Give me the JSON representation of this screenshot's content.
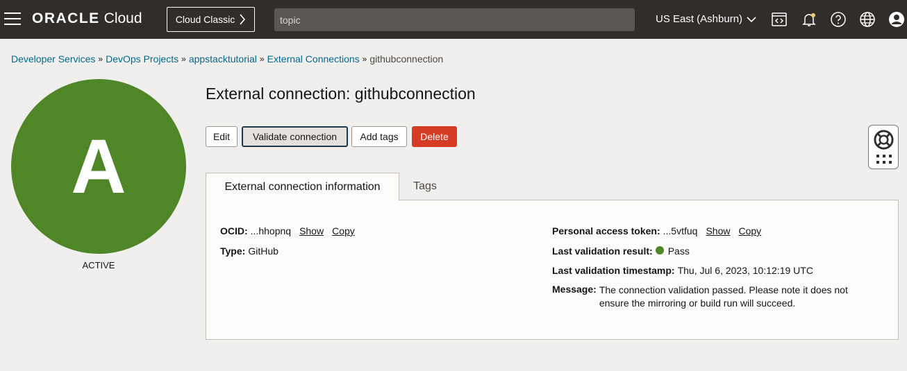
{
  "header": {
    "logo_brand": "ORACLE",
    "logo_product": "Cloud",
    "classic_label": "Cloud Classic",
    "search_value": "topic",
    "region": "US East (Ashburn)"
  },
  "breadcrumb": {
    "items": [
      "Developer Services",
      "DevOps Projects",
      "appstacktutorial",
      "External Connections"
    ],
    "current": "githubconnection"
  },
  "resource": {
    "avatar_letter": "A",
    "status": "ACTIVE",
    "status_color": "#4e8628"
  },
  "page_title": "External connection: githubconnection",
  "actions": {
    "edit": "Edit",
    "validate": "Validate connection",
    "add_tags": "Add tags",
    "delete": "Delete"
  },
  "tabs": [
    {
      "label": "External connection information",
      "active": true
    },
    {
      "label": "Tags",
      "active": false
    }
  ],
  "details": {
    "ocid_label": "OCID:",
    "ocid_value": "...hhopnq",
    "type_label": "Type:",
    "type_value": "GitHub",
    "token_label": "Personal access token:",
    "token_value": "...5vtfuq",
    "show": "Show",
    "copy": "Copy",
    "validation_label": "Last validation result:",
    "validation_value": "Pass",
    "timestamp_label": "Last validation timestamp:",
    "timestamp_value": "Thu, Jul 6, 2023, 10:12:19 UTC",
    "message_label": "Message:",
    "message_value": "The connection validation passed. Please note it does not ensure the mirroring or build run will succeed."
  }
}
